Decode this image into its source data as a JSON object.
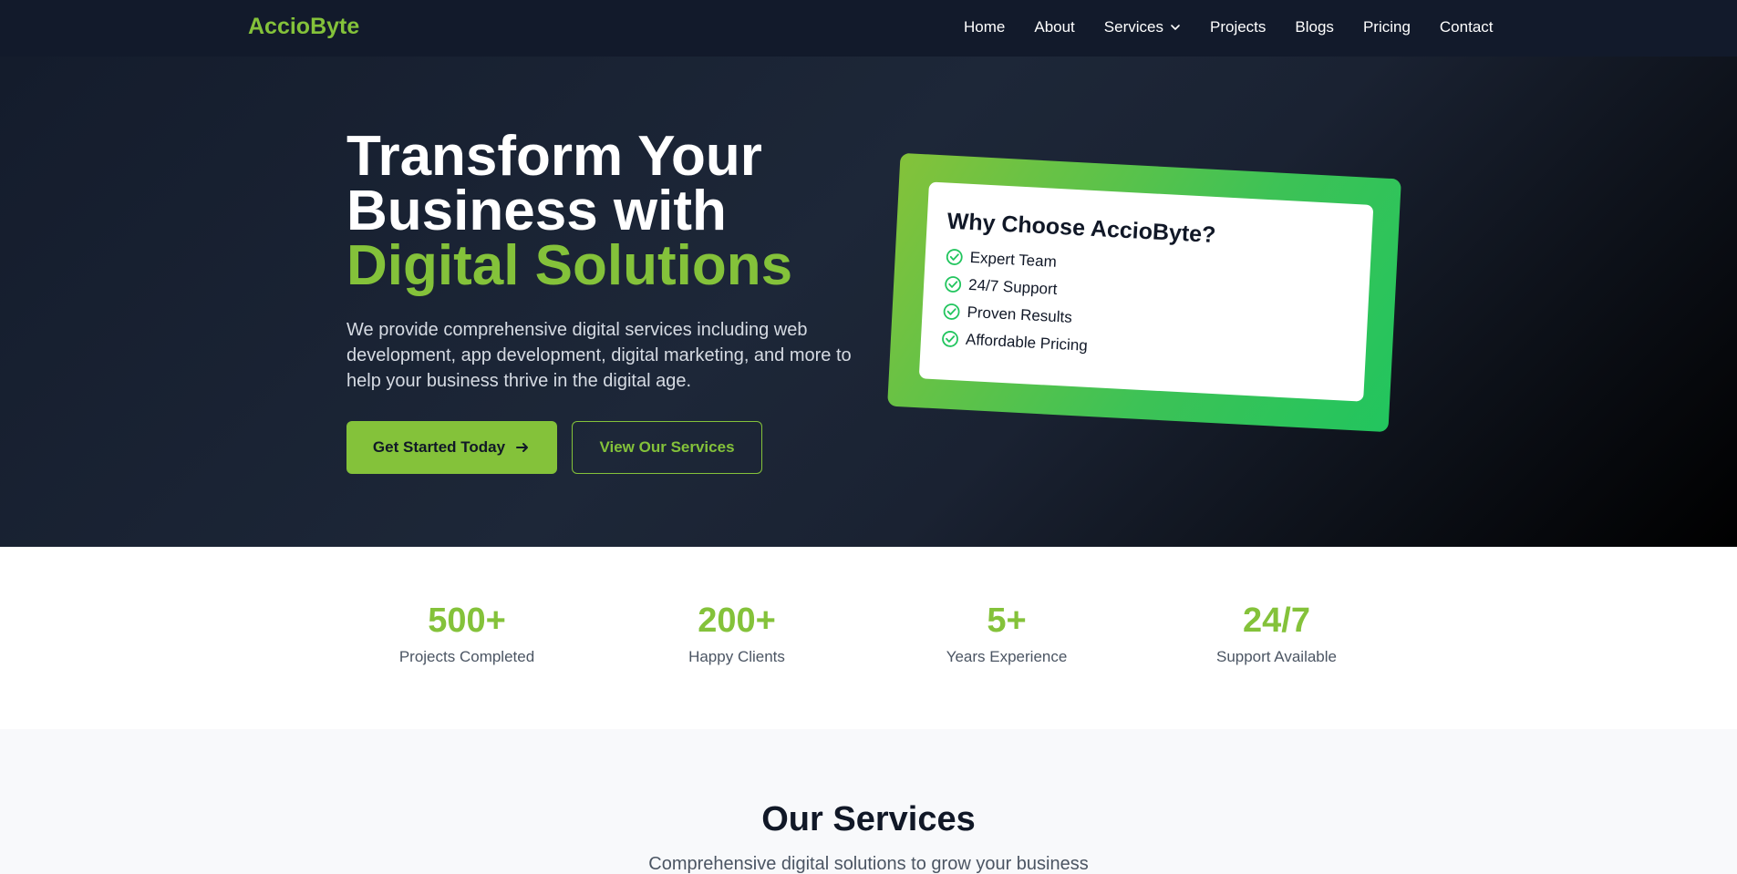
{
  "nav": {
    "logo": "AccioByte",
    "items": [
      {
        "label": "Home"
      },
      {
        "label": "About"
      },
      {
        "label": "Services",
        "has_dropdown": true
      },
      {
        "label": "Projects"
      },
      {
        "label": "Blogs"
      },
      {
        "label": "Pricing"
      },
      {
        "label": "Contact"
      }
    ]
  },
  "hero": {
    "title_line1": "Transform Your",
    "title_line2": "Business with",
    "title_highlight": "Digital Solutions",
    "description": "We provide comprehensive digital services including web development, app development, digital marketing, and more to help your business thrive in the digital age.",
    "primary_button": "Get Started Today",
    "secondary_button": "View Our Services",
    "card": {
      "title": "Why Choose AccioByte?",
      "items": [
        "Expert Team",
        "24/7 Support",
        "Proven Results",
        "Affordable Pricing"
      ]
    }
  },
  "stats": [
    {
      "number": "500+",
      "label": "Projects Completed"
    },
    {
      "number": "200+",
      "label": "Happy Clients"
    },
    {
      "number": "5+",
      "label": "Years Experience"
    },
    {
      "number": "24/7",
      "label": "Support Available"
    }
  ],
  "services": {
    "title": "Our Services",
    "subtitle": "Comprehensive digital solutions to grow your business"
  },
  "colors": {
    "accent": "#84c23a",
    "accent_alt": "#22c55e",
    "nav_bg": "#121a2b",
    "hero_bg": "#1d2738"
  }
}
